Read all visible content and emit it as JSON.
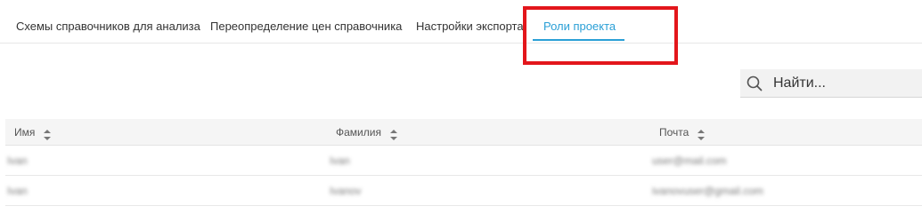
{
  "tabs": [
    {
      "label": "Схемы справочников для анализа",
      "active": false
    },
    {
      "label": "Переопределение цен справочника",
      "active": false
    },
    {
      "label": "Настройки экспорта",
      "active": false
    },
    {
      "label": "Роли проекта",
      "active": true
    }
  ],
  "search": {
    "placeholder": "Найти..."
  },
  "table": {
    "columns": [
      "Имя",
      "Фамилия",
      "Почта"
    ],
    "rows": [
      [
        "Ivan",
        "Ivan",
        "user@mail.com"
      ],
      [
        "Ivan",
        "Ivanov",
        "ivanovuser@gmail.com"
      ]
    ]
  },
  "colors": {
    "accent": "#2a9fd6",
    "highlight": "#e3161b"
  },
  "icons": {
    "search": "search-icon",
    "sort": "sort-icon"
  }
}
